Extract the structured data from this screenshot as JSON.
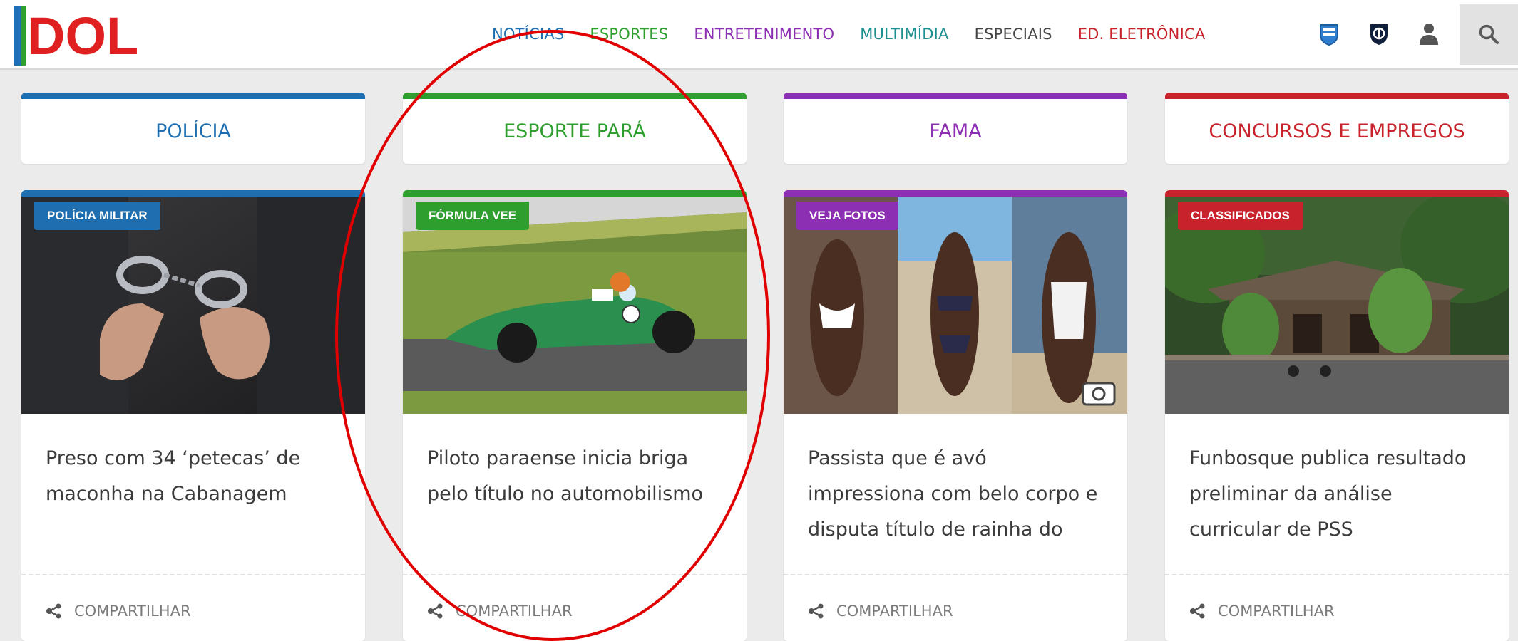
{
  "header": {
    "logo_text": "DOL",
    "nav": [
      {
        "label": "NOTÍCIAS",
        "color": "#1f6fb0"
      },
      {
        "label": "ESPORTES",
        "color": "#2e9e2e"
      },
      {
        "label": "ENTRETENIMENTO",
        "color": "#8c2fb3"
      },
      {
        "label": "MULTIMÍDIA",
        "color": "#1d8f8f"
      },
      {
        "label": "ESPECIAIS",
        "color": "#444444"
      },
      {
        "label": "ED. ELETRÔNICA",
        "color": "#c8232c"
      }
    ],
    "icons": [
      "paysandu-crest-icon",
      "remo-crest-icon",
      "user-icon",
      "search-icon"
    ]
  },
  "sections": [
    {
      "label": "POLÍCIA",
      "color": "#1f6fb0"
    },
    {
      "label": "ESPORTE PARÁ",
      "color": "#2e9e2e"
    },
    {
      "label": "FAMA",
      "color": "#8c2fb3"
    },
    {
      "label": "CONCURSOS E EMPREGOS",
      "color": "#c8232c"
    }
  ],
  "cards": [
    {
      "badge": "POLÍCIA MILITAR",
      "title": "Preso com 34 ‘petecas’ de maconha na Cabanagem",
      "share": "COMPARTILHAR",
      "color": "#1f6fb0"
    },
    {
      "badge": "FÓRMULA VEE",
      "title": "Piloto paraense inicia briga pelo título no automobilismo",
      "share": "COMPARTILHAR",
      "color": "#2e9e2e"
    },
    {
      "badge": "VEJA FOTOS",
      "title": "Passista que é avó impressiona com belo corpo e disputa título de rainha do",
      "share": "COMPARTILHAR",
      "color": "#8c2fb3"
    },
    {
      "badge": "CLASSIFICADOS",
      "title": "Funbosque publica resultado preliminar da análise curricular de PSS",
      "share": "COMPARTILHAR",
      "color": "#c8232c"
    }
  ]
}
